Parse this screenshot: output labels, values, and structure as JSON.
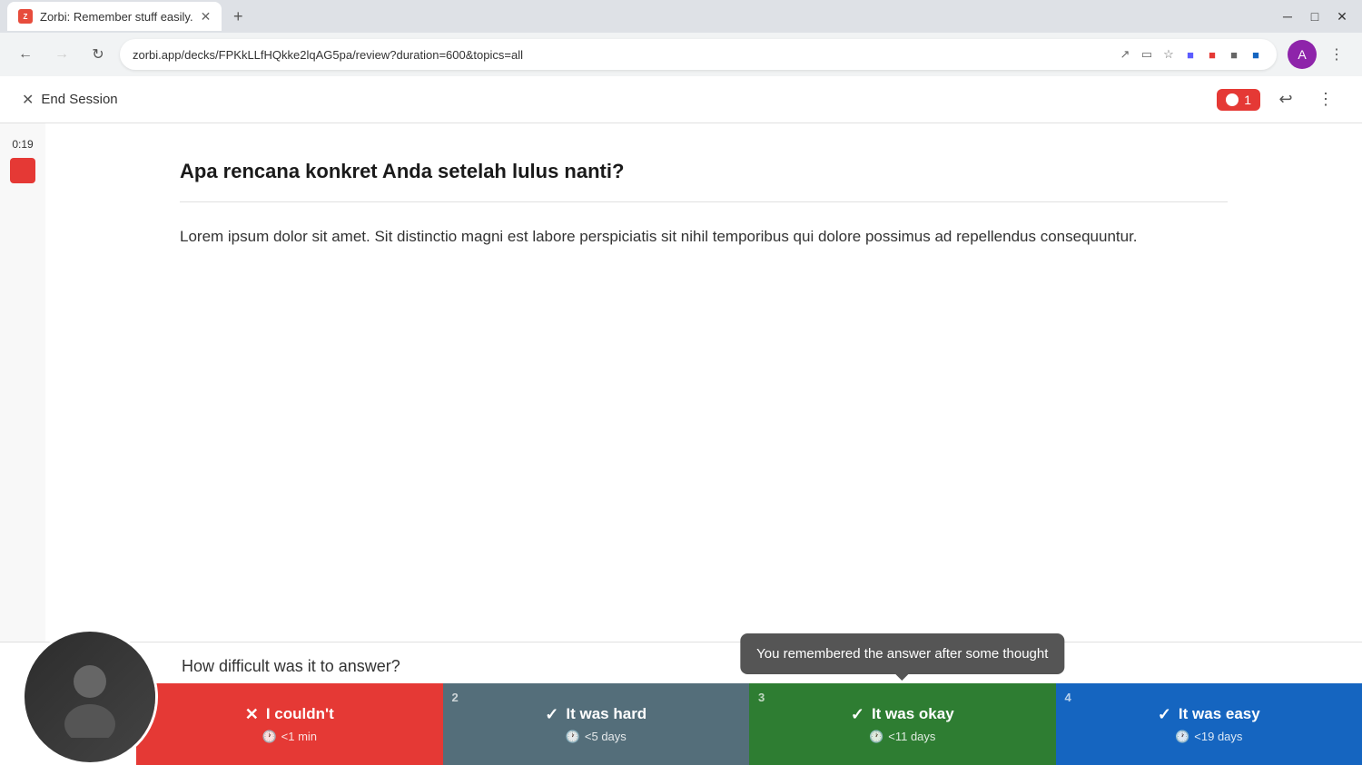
{
  "browser": {
    "tab_title": "Zorbi: Remember stuff easily.",
    "url": "zorbi.app/decks/FPKkLLfHQkke2lqAG5pa/review?duration=600&topics=all"
  },
  "toolbar": {
    "end_session_label": "End Session",
    "record_count": "1"
  },
  "timer": {
    "time": "0:19"
  },
  "card": {
    "question": "Apa rencana konkret Anda setelah lulus nanti?",
    "answer": "Lorem ipsum dolor sit amet. Sit distinctio magni est labore perspiciatis sit nihil temporibus qui dolore possimus ad repellendus consequuntur."
  },
  "rating": {
    "prompt": "How difficult was it to answer?",
    "tooltip": "You remembered the answer after some thought",
    "buttons": [
      {
        "number": "",
        "label": "I couldn't",
        "days": "<1 min",
        "color": "btn-1"
      },
      {
        "number": "2",
        "label": "It was hard",
        "days": "<5 days",
        "color": "btn-2"
      },
      {
        "number": "3",
        "label": "It was okay",
        "days": "<11 days",
        "color": "btn-3"
      },
      {
        "number": "4",
        "label": "It was easy",
        "days": "<19 days",
        "color": "btn-4"
      }
    ]
  }
}
